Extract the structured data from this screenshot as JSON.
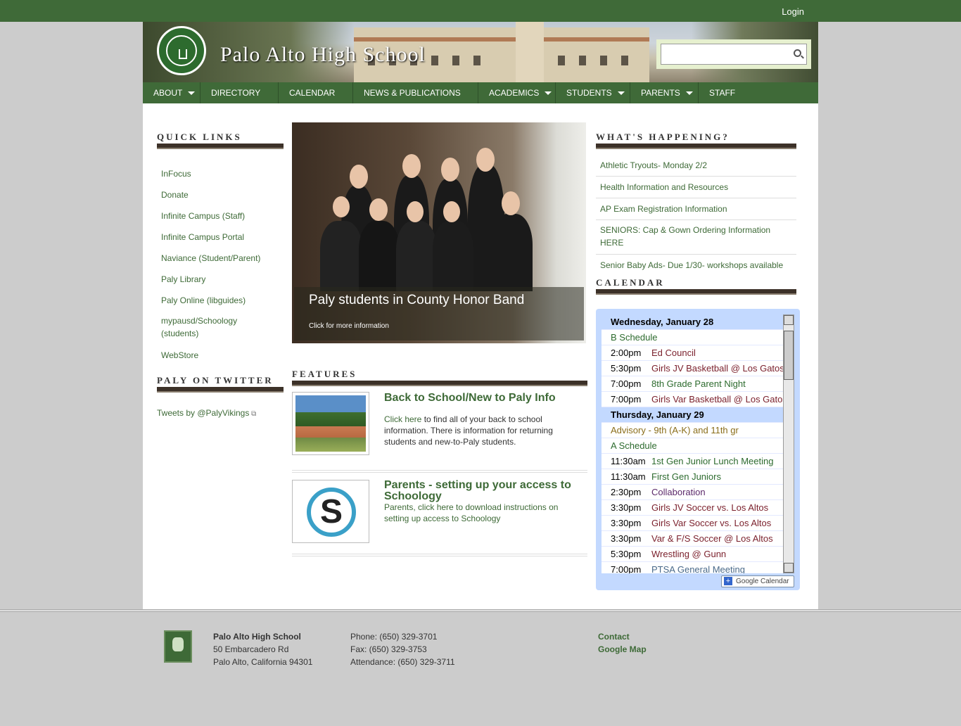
{
  "header": {
    "login": "Login",
    "site_title": "Palo Alto High School",
    "search_placeholder": ""
  },
  "nav": [
    {
      "label": "ABOUT",
      "has_sub": true
    },
    {
      "label": "DIRECTORY",
      "has_sub": false
    },
    {
      "label": "CALENDAR",
      "has_sub": false
    },
    {
      "label": "NEWS & PUBLICATIONS",
      "has_sub": false
    },
    {
      "label": "ACADEMICS",
      "has_sub": true
    },
    {
      "label": "STUDENTS",
      "has_sub": true
    },
    {
      "label": "PARENTS",
      "has_sub": true
    },
    {
      "label": "STAFF",
      "has_sub": true
    }
  ],
  "sidebar": {
    "quick_links_title": "QUICK LINKS",
    "quick_links": [
      "InFocus",
      "Donate",
      "Infinite Campus (Staff)",
      "Infinite Campus Portal",
      "Naviance (Student/Parent)",
      "Paly Library",
      "Paly Online (libguides)",
      "mypausd/Schoology (students)",
      "WebStore"
    ],
    "twitter_title": "PALY ON TWITTER",
    "twitter_link": "Tweets by @PalyVikings"
  },
  "slider": {
    "caption_title": "Paly students in County Honor Band",
    "caption_sub": "Click for more information"
  },
  "features": {
    "title": "FEATURES",
    "items": [
      {
        "title": "Back to School/New to Paly Info",
        "link": "Click here",
        "body": "to find all of your back to school information. There is information for returning students and new-to-Paly students."
      },
      {
        "title": "Parents - setting up your access to Schoology",
        "link": "",
        "body": "Parents, click here to download instructions on setting up access to Schoology"
      }
    ]
  },
  "whats_happening": {
    "title": "WHAT'S HAPPENING?",
    "items": [
      "Athletic Tryouts- Monday 2/2",
      "Health Information and Resources",
      "AP Exam Registration Information",
      "SENIORS: Cap & Gown Ordering Information HERE",
      "Senior Baby Ads- Due 1/30- workshops available"
    ]
  },
  "calendar": {
    "title": "CALENDAR",
    "button": "Google Calendar",
    "rows": [
      {
        "type": "day",
        "text": "Wednesday, January 28"
      },
      {
        "type": "allday",
        "text": "B Schedule",
        "color": "#2d6b2e"
      },
      {
        "type": "event",
        "time": "2:00pm",
        "text": "Ed Council",
        "color": "#7a1f2b"
      },
      {
        "type": "event",
        "time": "5:30pm",
        "text": "Girls JV Basketball @ Los Gatos",
        "color": "#7a1f2b"
      },
      {
        "type": "event",
        "time": "7:00pm",
        "text": "8th Grade Parent Night",
        "color": "#2d6b2e"
      },
      {
        "type": "event",
        "time": "7:00pm",
        "text": "Girls Var Basketball @ Los Gatos",
        "color": "#7a1f2b"
      },
      {
        "type": "day",
        "text": "Thursday, January 29"
      },
      {
        "type": "allday",
        "text": "Advisory - 9th (A-K) and 11th gr",
        "color": "#8a6d1a"
      },
      {
        "type": "allday",
        "text": "A Schedule",
        "color": "#2d6b2e"
      },
      {
        "type": "event",
        "time": "11:30am",
        "text": "1st Gen Junior Lunch Meeting",
        "color": "#2d6b2e"
      },
      {
        "type": "event",
        "time": "11:30am",
        "text": "First Gen Juniors",
        "color": "#2d6b2e"
      },
      {
        "type": "event",
        "time": "2:30pm",
        "text": "Collaboration",
        "color": "#5c2a6b"
      },
      {
        "type": "event",
        "time": "3:30pm",
        "text": "Girls JV Soccer vs. Los Altos",
        "color": "#7a1f2b"
      },
      {
        "type": "event",
        "time": "3:30pm",
        "text": "Girls Var Soccer vs. Los Altos",
        "color": "#7a1f2b"
      },
      {
        "type": "event",
        "time": "3:30pm",
        "text": "Var & F/S Soccer @ Los Altos",
        "color": "#7a1f2b"
      },
      {
        "type": "event",
        "time": "5:30pm",
        "text": "Wrestling @ Gunn",
        "color": "#7a1f2b"
      },
      {
        "type": "event",
        "time": "7:00pm",
        "text": "PTSA General Meeting",
        "color": "#4a6a8a"
      }
    ]
  },
  "footer": {
    "school": "Palo Alto High School",
    "address1": "50 Embarcadero Rd",
    "address2": "Palo Alto, California 94301",
    "phone": "Phone: (650) 329-3701",
    "fax": "Fax: (650) 329-3753",
    "attendance": "Attendance: (650) 329-3711",
    "contact": "Contact",
    "map": "Google Map"
  }
}
